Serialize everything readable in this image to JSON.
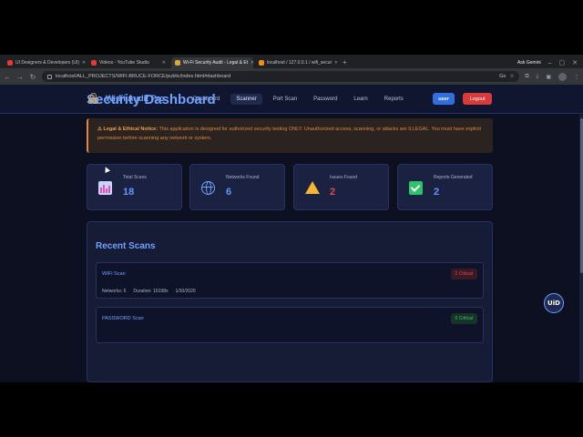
{
  "browser": {
    "tabs": [
      {
        "title": "UI Designers & Developers (UI)",
        "favicon_color": "#e53935"
      },
      {
        "title": "Videos - YouTube Studio",
        "favicon_color": "#e53935"
      },
      {
        "title": "Wi-Fi Security Audit - Legal & Et",
        "favicon_color": "#e0a63a"
      },
      {
        "title": "localhost / 127.0.0.1 / wifi_secur",
        "favicon_color": "#f29111"
      }
    ],
    "ask_gemini": "Ask Gemini",
    "url": "localhost/ALL_PROJECTS/WIFI-BRUCE-FORCE/public/index.html#dashboard",
    "zoom": "Go"
  },
  "app": {
    "brand_title": "Wi-Fi Audit Pro",
    "nav": [
      {
        "label": "Dashboard",
        "active": false
      },
      {
        "label": "Scanner",
        "active": true
      },
      {
        "label": "Port Scan",
        "active": false
      },
      {
        "label": "Password",
        "active": false
      },
      {
        "label": "Learn",
        "active": false
      },
      {
        "label": "Reports",
        "active": false
      }
    ],
    "user_label": "user",
    "logout_label": "Logout"
  },
  "main": {
    "title": "Security Dashboard",
    "notice_heading": "⚠ Legal & Ethical Notice:",
    "notice_text": " This application is designed for authorized security testing ONLY. Unauthorized access, scanning, or attacks are ILLEGAL. You must have explicit permission before scanning any network or system.",
    "stats": [
      {
        "label": "Total Scans",
        "value": "18",
        "icon": "chart-icon"
      },
      {
        "label": "Networks Found",
        "value": "6",
        "icon": "globe-icon"
      },
      {
        "label": "Issues Found",
        "value": "2",
        "icon": "warning-icon"
      },
      {
        "label": "Reports Generated",
        "value": "2",
        "icon": "check-icon"
      }
    ],
    "recent_title": "Recent Scans",
    "scans": [
      {
        "name": "WIFI Scan",
        "badge": "2 Critical",
        "networks": "Networks: 6",
        "duration": "Duration: 16198s",
        "date": "1/30/2026"
      },
      {
        "name": "PASSWORD Scan",
        "badge": "0 Critical",
        "networks": "",
        "duration": "",
        "date": ""
      }
    ]
  },
  "watermark": "UiD",
  "colors": {
    "accent": "#6fa3ff",
    "danger": "#d93a3a",
    "warning": "#e0893a",
    "bg": "#0d1020"
  }
}
